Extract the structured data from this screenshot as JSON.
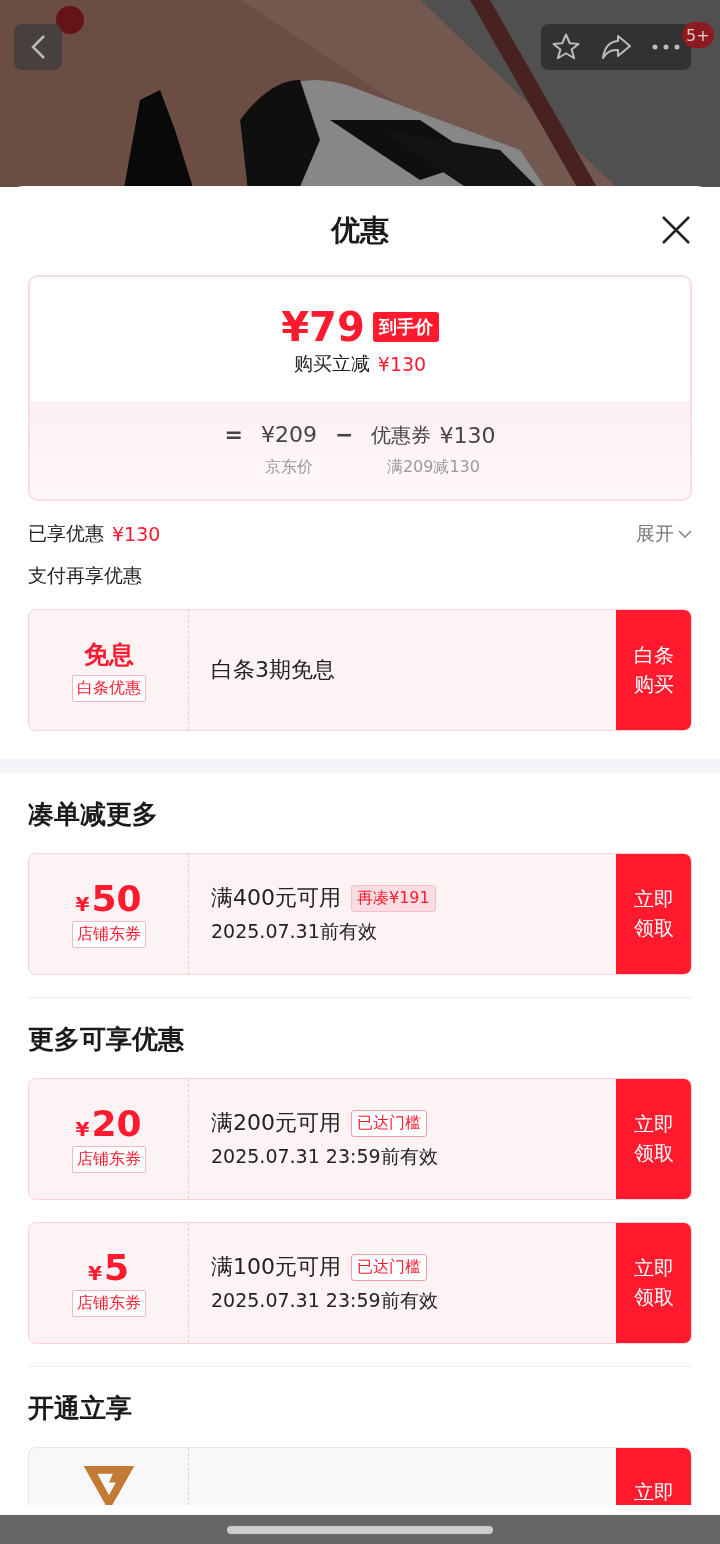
{
  "badge": "5+",
  "sheet": {
    "title": "优惠"
  },
  "price_card": {
    "final_price": "¥79",
    "final_tag": "到手价",
    "saving_label": "购买立减",
    "saving_amount": "¥130",
    "equals": "=",
    "base_price": "¥209",
    "minus": "−",
    "coupon_label": "优惠券",
    "coupon_amount": "¥130",
    "base_caption": "京东价",
    "coupon_caption": "满209减130"
  },
  "enjoyed": {
    "label": "已享优惠",
    "amount": "¥130",
    "toggle": "展开",
    "expanded": false
  },
  "pay_title": "支付再享优惠",
  "pay_offer": {
    "kind": "text",
    "big": "免息",
    "tag": "白条优惠",
    "condition": "白条3期免息",
    "button": "白条购买"
  },
  "sections": [
    {
      "title": "凑单减更多",
      "coupons": [
        {
          "kind": "amount",
          "currency": "¥",
          "amount": "50",
          "tag": "店铺东券",
          "condition": "满400元可用",
          "hint": "再凑¥191",
          "hint_filled": true,
          "validity": "2025.07.31前有效",
          "button": "立即领取"
        }
      ]
    },
    {
      "title": "更多可享优惠",
      "coupons": [
        {
          "kind": "amount",
          "currency": "¥",
          "amount": "20",
          "tag": "店铺东券",
          "condition": "满200元可用",
          "hint": "已达门槛",
          "hint_filled": false,
          "validity": "2025.07.31 23:59前有效",
          "button": "立即领取"
        },
        {
          "kind": "amount",
          "currency": "¥",
          "amount": "5",
          "tag": "店铺东券",
          "condition": "满100元可用",
          "hint": "已达门槛",
          "hint_filled": false,
          "validity": "2025.07.31 23:59前有效",
          "button": "立即领取"
        }
      ]
    },
    {
      "title": "开通立享",
      "coupons": [
        {
          "kind": "logo",
          "button": "立即"
        }
      ]
    }
  ]
}
